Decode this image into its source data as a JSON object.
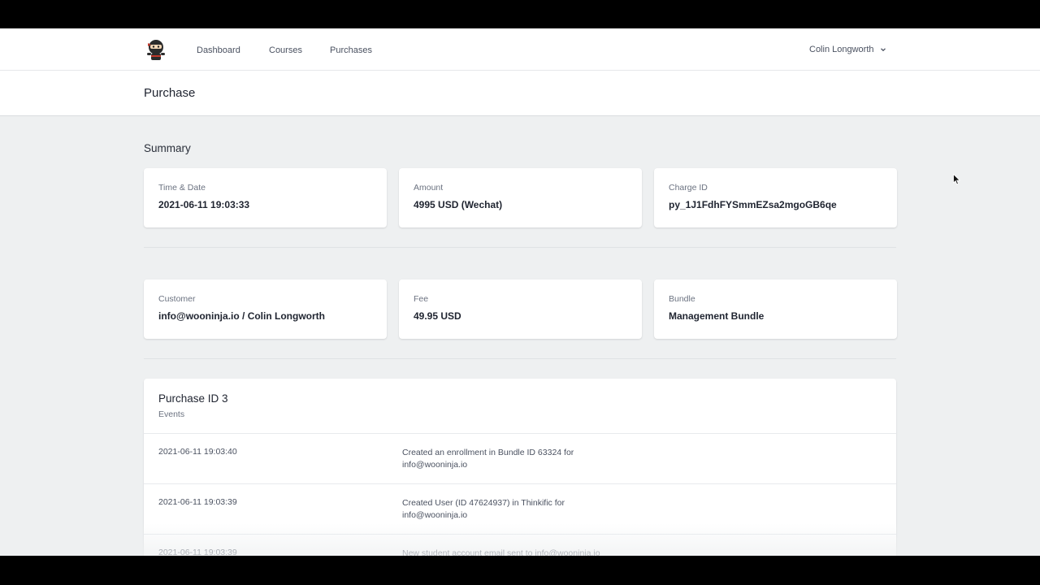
{
  "nav": {
    "links": [
      "Dashboard",
      "Courses",
      "Purchases"
    ],
    "user": "Colin Longworth"
  },
  "page": {
    "title": "Purchase"
  },
  "summary": {
    "title": "Summary",
    "cards": [
      {
        "label": "Time & Date",
        "value": "2021-06-11 19:03:33"
      },
      {
        "label": "Amount",
        "value": "4995 USD (Wechat)"
      },
      {
        "label": "Charge ID",
        "value": "py_1J1FdhFYSmmEZsa2mgoGB6qe"
      },
      {
        "label": "Customer",
        "value": "info@wooninja.io / Colin Longworth"
      },
      {
        "label": "Fee",
        "value": "49.95 USD"
      },
      {
        "label": "Bundle",
        "value": "Management Bundle"
      }
    ]
  },
  "events": {
    "title": "Purchase ID 3",
    "subtitle": "Events",
    "rows": [
      {
        "time": "2021-06-11 19:03:40",
        "desc": "Created an enrollment in Bundle ID 63324 for info@wooninja.io"
      },
      {
        "time": "2021-06-11 19:03:39",
        "desc": "Created User (ID 47624937) in Thinkific for info@wooninja.io"
      },
      {
        "time": "2021-06-11 19:03:39",
        "desc": "New student account email sent to info@wooninja.io"
      }
    ]
  }
}
